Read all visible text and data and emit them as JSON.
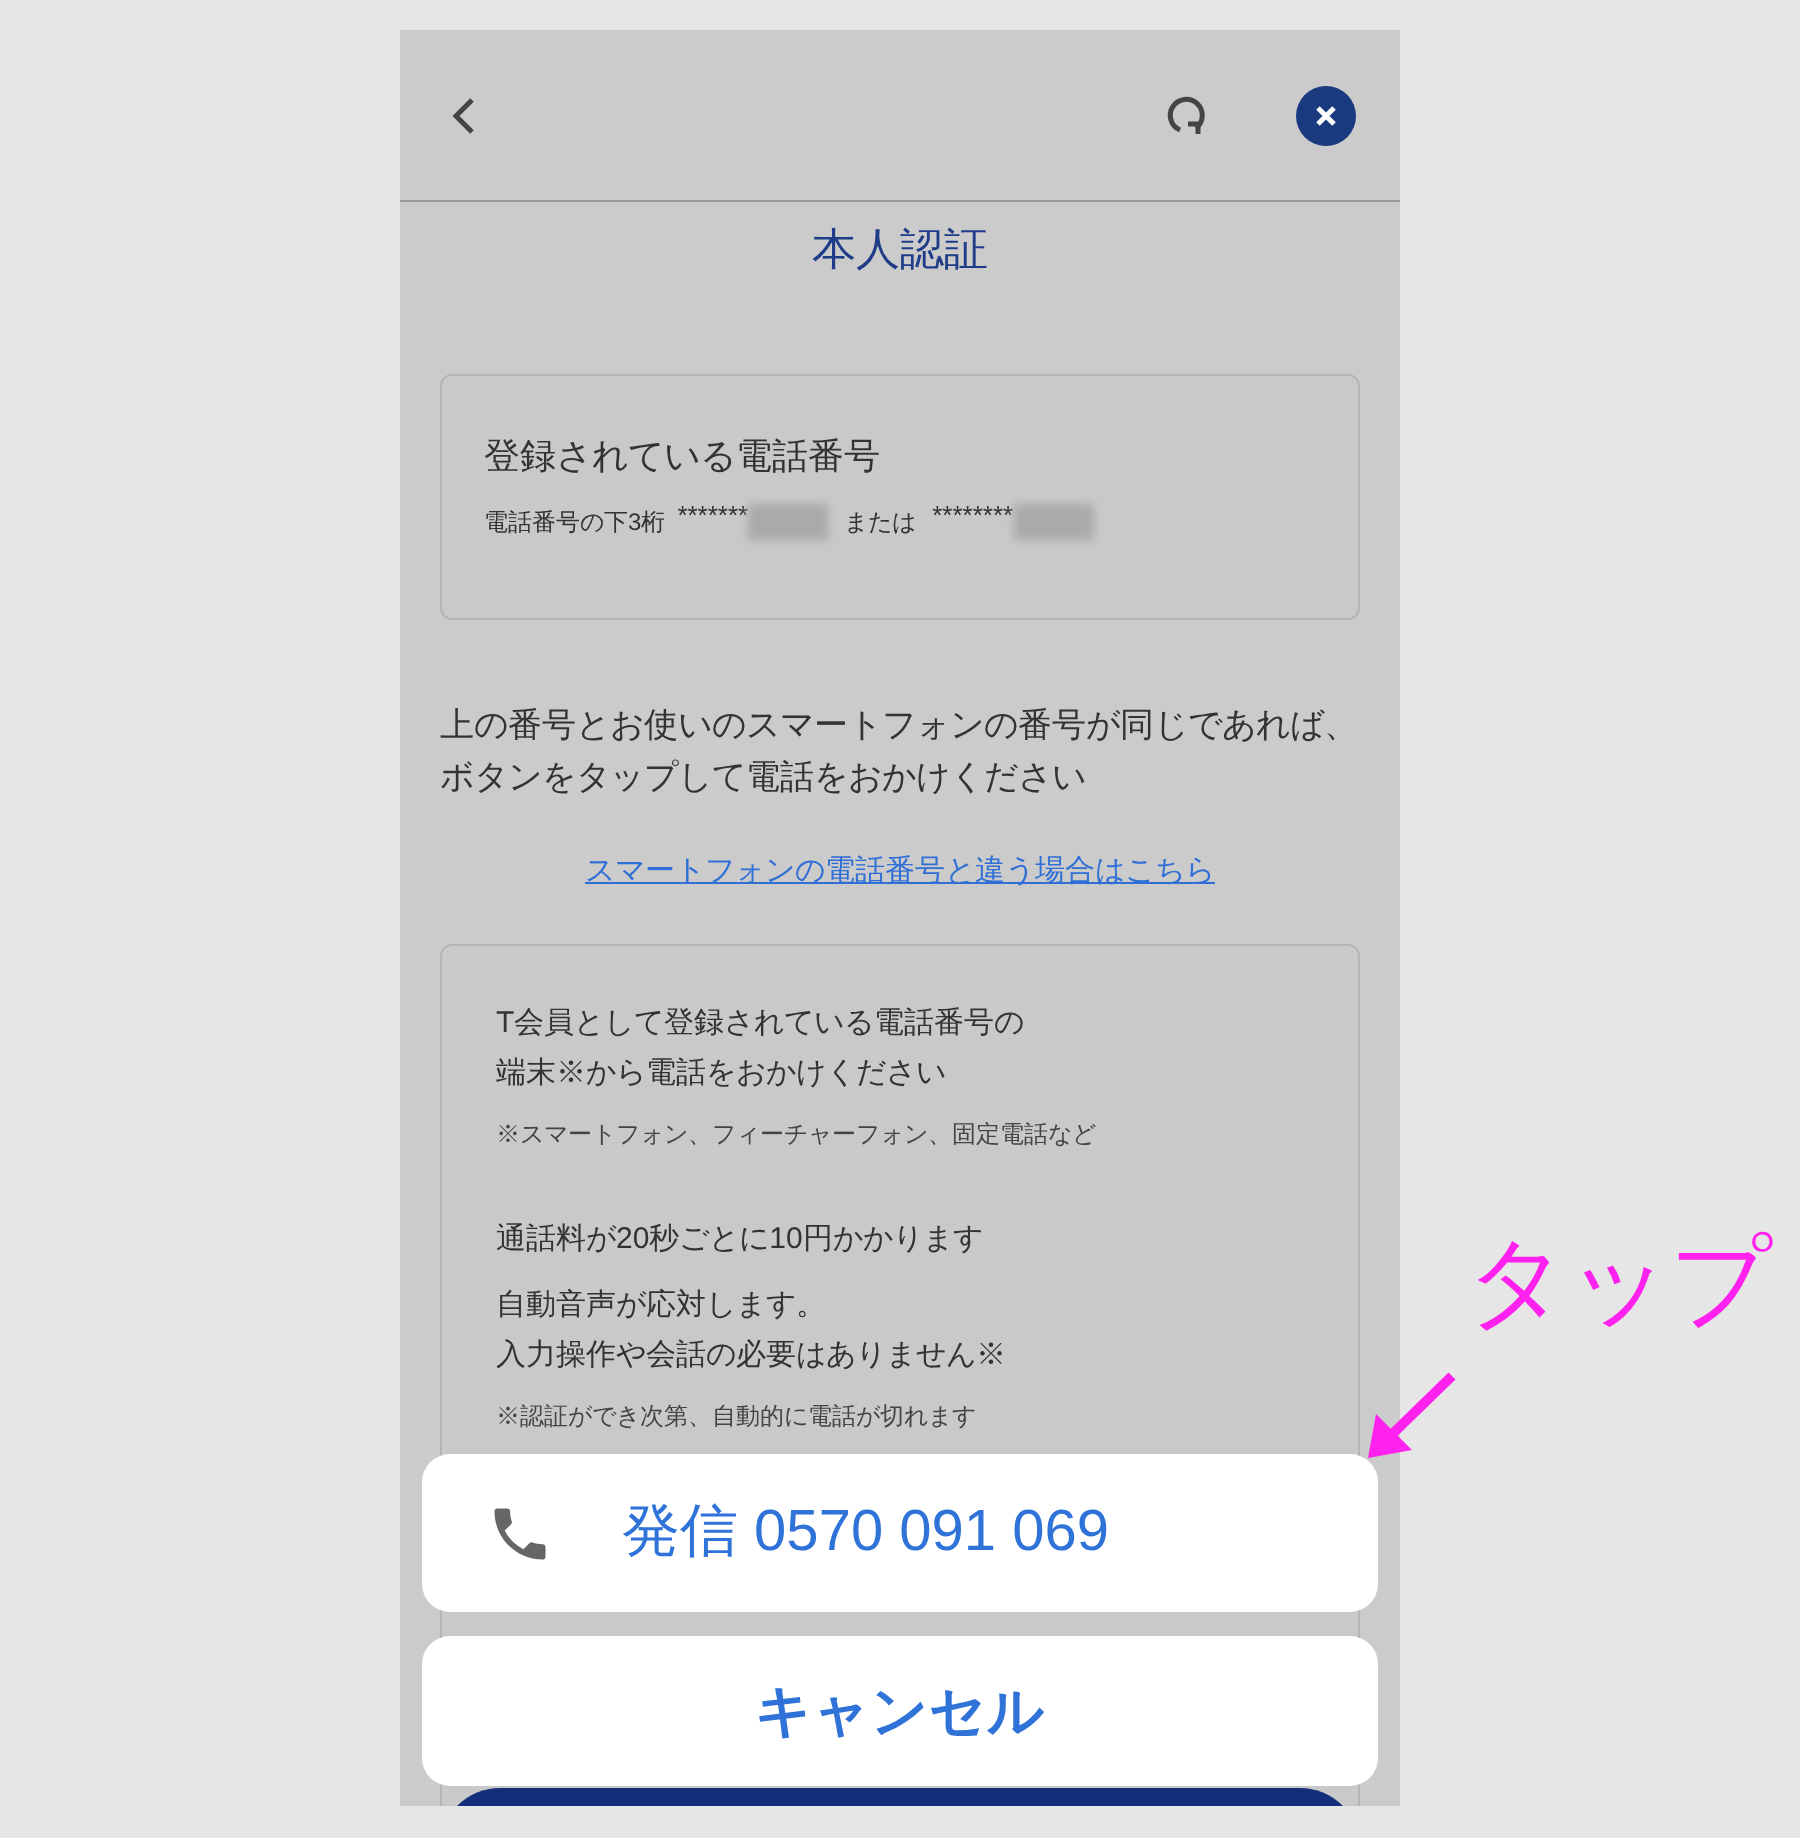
{
  "header": {
    "title": "本人認証"
  },
  "registered_card": {
    "heading": "登録されている電話番号",
    "label": "電話番号の下3桁",
    "masked_1": "*******",
    "separator": "または",
    "masked_2": "********"
  },
  "instruction": "上の番号とお使いのスマートフォンの番号が同じであれば、ボタンをタップして電話をおかけください",
  "link": "スマートフォンの電話番号と違う場合はこちら",
  "info_card": {
    "lines": [
      {
        "kind": "line",
        "text": "T会員として登録されている電話番号の"
      },
      {
        "kind": "main",
        "text": "端末※から電話をおかけください"
      },
      {
        "kind": "note",
        "text": "※スマートフォン、フィーチャーフォン、固定電話など"
      },
      {
        "kind": "main",
        "text": "通話料が20秒ごとに10円かかります"
      },
      {
        "kind": "line",
        "text": "自動音声が応対します。"
      },
      {
        "kind": "main",
        "text": "入力操作や会話の必要はありません※"
      },
      {
        "kind": "note",
        "text": "※認証ができ次第、自動的に電話が切れます"
      }
    ]
  },
  "action_sheet": {
    "call_button": "発信 0570 091 069",
    "cancel_button": "キャンセル"
  },
  "annotation": {
    "text": "タップ"
  }
}
